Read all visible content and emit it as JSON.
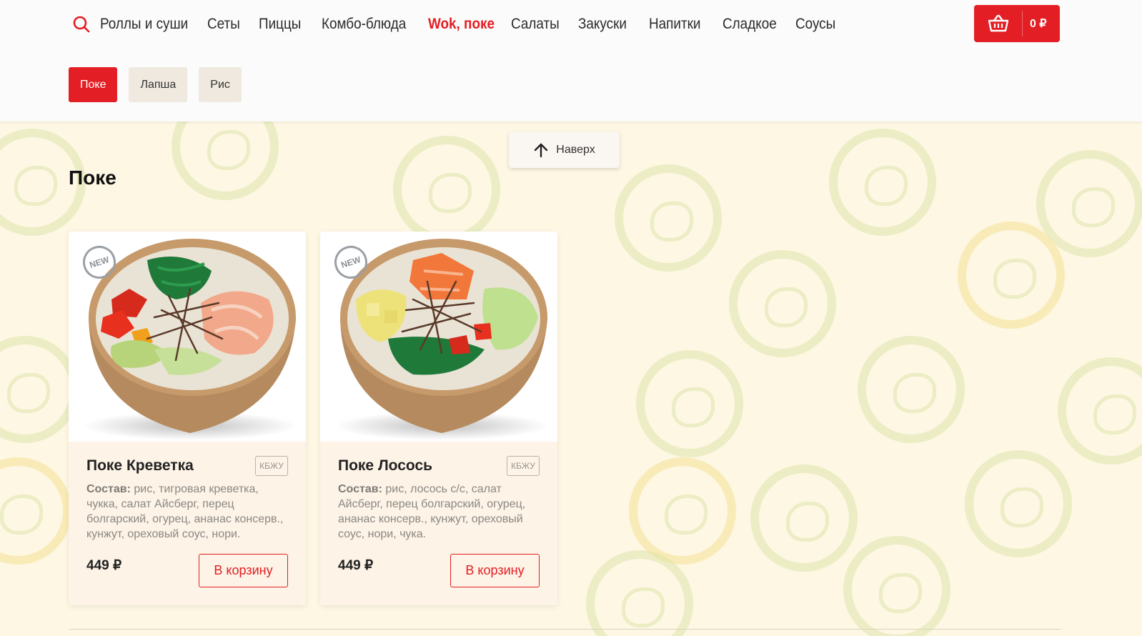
{
  "header": {
    "nav": [
      {
        "label": "Роллы и суши",
        "active": false
      },
      {
        "label": "Сеты",
        "active": false
      },
      {
        "label": "Пиццы",
        "active": false
      },
      {
        "label": "Комбо-блюда",
        "active": false
      },
      {
        "label": "Wok, поке",
        "active": true
      },
      {
        "label": "Салаты",
        "active": false
      },
      {
        "label": "Закуски",
        "active": false
      },
      {
        "label": "Напитки",
        "active": false
      },
      {
        "label": "Сладкое",
        "active": false
      },
      {
        "label": "Соусы",
        "active": false
      }
    ],
    "cart_total": "0 ₽",
    "search_icon": "search-icon",
    "cart_icon": "basket-icon"
  },
  "subtabs": [
    {
      "label": "Поке",
      "active": true
    },
    {
      "label": "Лапша",
      "active": false
    },
    {
      "label": "Рис",
      "active": false
    }
  ],
  "to_top": {
    "label": "Наверх",
    "icon": "arrow-up-icon"
  },
  "section": {
    "title": "Поке"
  },
  "products": [
    {
      "badge": "NEW",
      "name": "Поке Креветка",
      "kbju": "КБЖУ",
      "desc_label": "Состав:",
      "desc": "рис, тигровая креветка, чукка, салат Айсберг, перец болгарский, огурец, ананас консерв., кунжут, ореховый соус, нори.",
      "price": "449 ₽",
      "button": "В корзину"
    },
    {
      "badge": "NEW",
      "name": "Поке Лосось",
      "kbju": "КБЖУ",
      "desc_label": "Состав:",
      "desc": "рис, лосось с/с, салат Айсберг, перец болгарский, огурец, ананас консерв., кунжут, ореховый соус, нори, чука.",
      "price": "449 ₽",
      "button": "В корзину"
    }
  ],
  "colors": {
    "accent": "#e31e24",
    "background": "#fdf7e3",
    "card": "#fdf3e6"
  }
}
